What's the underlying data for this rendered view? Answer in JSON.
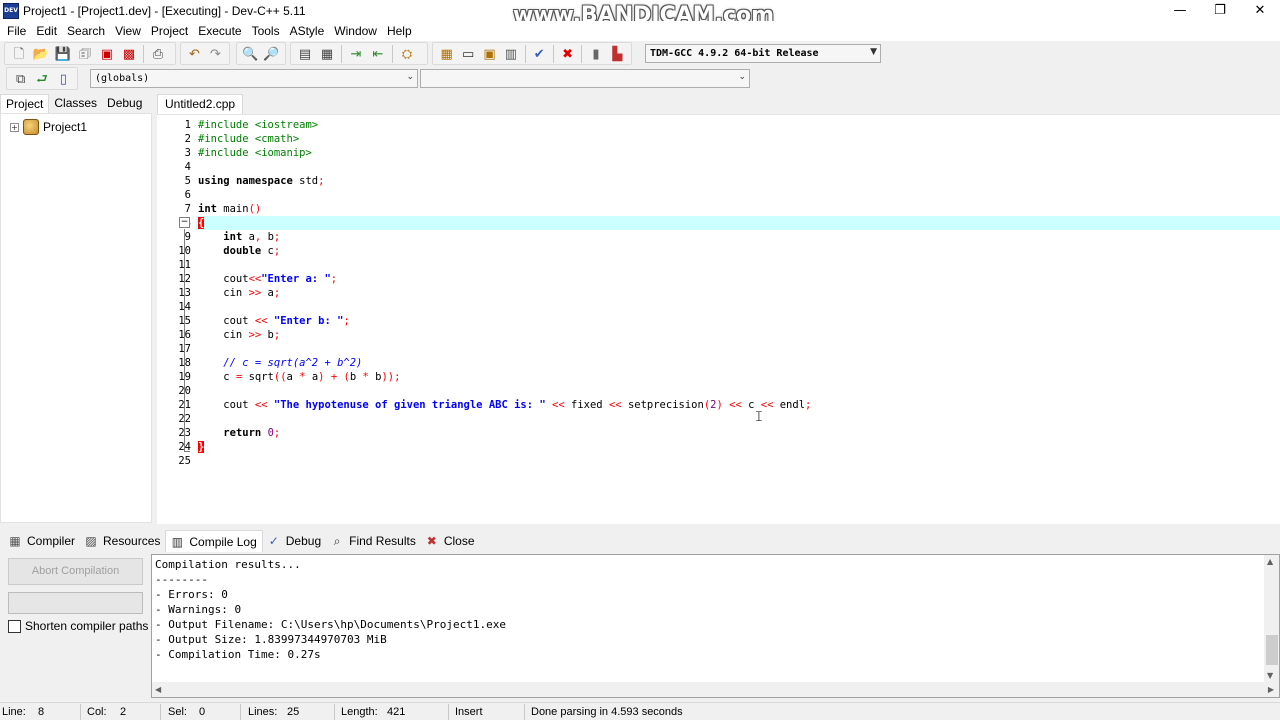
{
  "window": {
    "title": "Project1 - [Project1.dev] - [Executing] - Dev-C++ 5.11",
    "icon_text": "DEV",
    "watermark": "www.BANDICAM.com",
    "controls": {
      "minimize": "—",
      "restore": "❐",
      "close": "✕"
    }
  },
  "menu": [
    {
      "label": "File",
      "id": "file"
    },
    {
      "label": "Edit",
      "id": "edit"
    },
    {
      "label": "Search",
      "id": "search"
    },
    {
      "label": "View",
      "id": "view"
    },
    {
      "label": "Project",
      "id": "project"
    },
    {
      "label": "Execute",
      "id": "execute"
    },
    {
      "label": "Tools",
      "id": "tools"
    },
    {
      "label": "AStyle",
      "id": "astyle"
    },
    {
      "label": "Window",
      "id": "window"
    },
    {
      "label": "Help",
      "id": "help"
    }
  ],
  "toolbar": {
    "compiler_select": "TDM-GCC 4.9.2 64-bit Release",
    "globals_select": "(globals)",
    "members_select": ""
  },
  "left_panel": {
    "tabs": [
      "Project",
      "Classes",
      "Debug"
    ],
    "active_tab": "Project",
    "tree": [
      {
        "label": "Project1",
        "expander": "+"
      }
    ]
  },
  "editor": {
    "tab": "Untitled2.cpp",
    "current_line": 8,
    "fold_marker": "−"
  },
  "code_lines": [
    "#include <iostream>",
    "#include <cmath>",
    "#include <iomanip>",
    "",
    "using namespace std;",
    "",
    "int main()",
    "{",
    "    int a, b;",
    "    double c;",
    "",
    "    cout<<\"Enter a: \";",
    "    cin >> a;",
    "",
    "    cout << \"Enter b: \";",
    "    cin >> b;",
    "",
    "    // c = sqrt(a^2 + b^2)",
    "    c = sqrt((a * a) + (b * b));",
    "",
    "    cout << \"The hypotenuse of given triangle ABC is: \" << fixed << setprecision(2) << c << endl;",
    "",
    "    return 0;",
    "}",
    ""
  ],
  "bottom_tabs": [
    {
      "label": "Compiler",
      "icon": "compiler-icon"
    },
    {
      "label": "Resources",
      "icon": "resources-icon"
    },
    {
      "label": "Compile Log",
      "icon": "compile-log-icon"
    },
    {
      "label": "Debug",
      "icon": "debug-icon"
    },
    {
      "label": "Find Results",
      "icon": "find-results-icon"
    },
    {
      "label": "Close",
      "icon": "close-icon"
    }
  ],
  "active_bottom_tab": "Compile Log",
  "compile_panel": {
    "abort_label": "Abort Compilation",
    "shorten_label": "Shorten compiler paths",
    "shorten_checked": false
  },
  "compile_log": [
    "Compilation results...",
    "--------",
    "- Errors: 0",
    "- Warnings: 0",
    "- Output Filename: C:\\Users\\hp\\Documents\\Project1.exe",
    "- Output Size: 1.83997344970703 MiB",
    "- Compilation Time: 0.27s"
  ],
  "status": {
    "line_label": "Line:",
    "line": "8",
    "col_label": "Col:",
    "col": "2",
    "sel_label": "Sel:",
    "sel": "0",
    "lines_label": "Lines:",
    "lines": "25",
    "length_label": "Length:",
    "length": "421",
    "mode": "Insert",
    "message": "Done parsing in 4.593 seconds"
  }
}
